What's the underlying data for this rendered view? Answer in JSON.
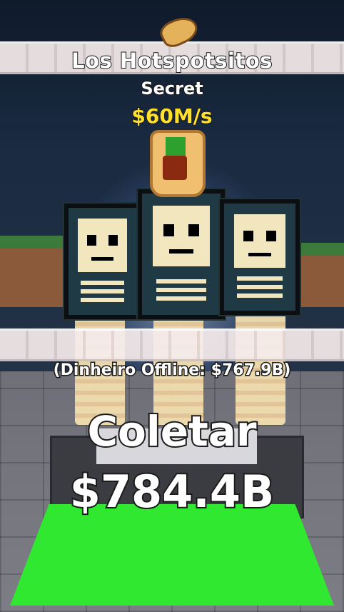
{
  "brainrot": {
    "name": "Los Hotspotsitos",
    "rarity": "Secret",
    "income_rate": "$60M/s"
  },
  "offline_earnings": "(Dinheiro Offline: $767.9B)",
  "collect": {
    "label": "Coletar",
    "amount": "$784.4B"
  },
  "colors": {
    "income_rate": "#ffe02a",
    "collect_pad": "#2fe82f",
    "text_outline": "#1a1a1a"
  },
  "icons": [
    "burrito-icon",
    "taco-icon"
  ]
}
